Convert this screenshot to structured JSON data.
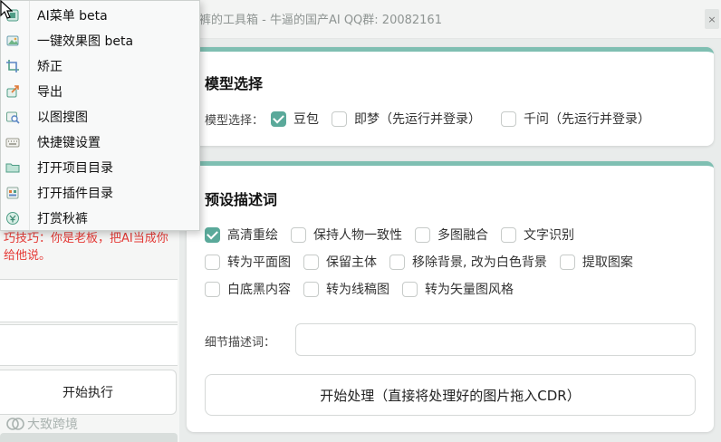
{
  "window": {
    "title": "裤的工具箱 - 牛逼的国产AI  QQ群: 20082161",
    "close_glyph": "×"
  },
  "left_panel": {
    "tip_lines": [
      "巧技巧：你是老板，把AI当成你",
      "给他说。"
    ],
    "execute_label": "开始执行",
    "watermark": "大致跨境"
  },
  "model_section": {
    "title": "模型选择",
    "label": "模型选择：",
    "options": [
      {
        "label": "豆包",
        "checked": true
      },
      {
        "label": "即梦（先运行并登录）",
        "checked": false
      },
      {
        "label": "千问（先运行并登录）",
        "checked": false
      }
    ]
  },
  "preset_section": {
    "title": "预设描述词",
    "rows": [
      [
        {
          "label": "高清重绘",
          "checked": true
        },
        {
          "label": "保持人物一致性",
          "checked": false
        },
        {
          "label": "多图融合",
          "checked": false
        },
        {
          "label": "文字识别",
          "checked": false
        }
      ],
      [
        {
          "label": "转为平面图",
          "checked": false
        },
        {
          "label": "保留主体",
          "checked": false
        },
        {
          "label": "移除背景, 改为白色背景",
          "checked": false
        },
        {
          "label": "提取图案",
          "checked": false
        }
      ],
      [
        {
          "label": "白底黑内容",
          "checked": false
        },
        {
          "label": "转为线稿图",
          "checked": false
        },
        {
          "label": "转为矢量图风格",
          "checked": false
        }
      ]
    ],
    "detail_label": "细节描述词：",
    "detail_value": "",
    "process_button": "开始处理（直接将处理好的图片拖入CDR）"
  },
  "context_menu": {
    "items": [
      {
        "label": "AI菜单 beta",
        "icon": "ai-menu-icon"
      },
      {
        "label": "一键效果图 beta",
        "icon": "image-effect-icon"
      },
      {
        "label": "矫正",
        "icon": "crop-correct-icon"
      },
      {
        "label": "导出",
        "icon": "export-icon"
      },
      {
        "label": "以图搜图",
        "icon": "image-search-icon"
      },
      {
        "label": "快捷键设置",
        "icon": "keyboard-icon"
      },
      {
        "label": "打开项目目录",
        "icon": "folder-icon"
      },
      {
        "label": "打开插件目录",
        "icon": "plugin-folder-icon"
      },
      {
        "label": "打赏秋裤",
        "icon": "reward-coin-icon"
      }
    ]
  },
  "colors": {
    "accent": "#5aa99a",
    "card_border": "#7fbfb2",
    "tip_red": "#e53935"
  }
}
